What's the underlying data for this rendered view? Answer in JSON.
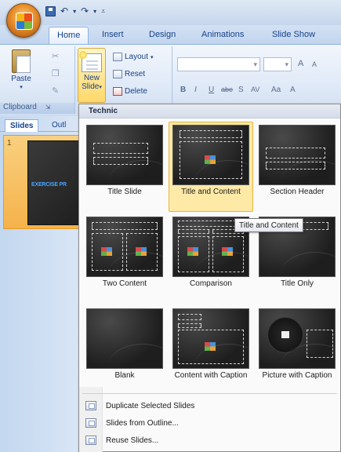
{
  "tabs": [
    "Home",
    "Insert",
    "Design",
    "Animations",
    "Slide Show"
  ],
  "ribbon": {
    "paste_label": "Paste",
    "new_slide_label_1": "New",
    "new_slide_label_2": "Slide",
    "layout_label": "Layout",
    "reset_label": "Reset",
    "delete_label": "Delete",
    "clipboard_label": "Clipboard",
    "format_buttons": [
      "B",
      "I",
      "U",
      "abe",
      "S",
      "AV",
      "Aa",
      "A"
    ],
    "font_grow": "A",
    "font_shrink": "A"
  },
  "slides_pane": {
    "tab_slides": "Slides",
    "tab_outline": "Outl",
    "slide_number": "1",
    "slide_text": "EXERCISE PR"
  },
  "menu": {
    "theme_name": "Technic",
    "layouts": [
      "Title Slide",
      "Title and Content",
      "Section Header",
      "Two Content",
      "Comparison",
      "Title Only",
      "Blank",
      "Content with Caption",
      "Picture with Caption"
    ],
    "tooltip": "Title and Content",
    "actions": [
      "Duplicate Selected Slides",
      "Slides from Outline...",
      "Reuse Slides..."
    ]
  }
}
